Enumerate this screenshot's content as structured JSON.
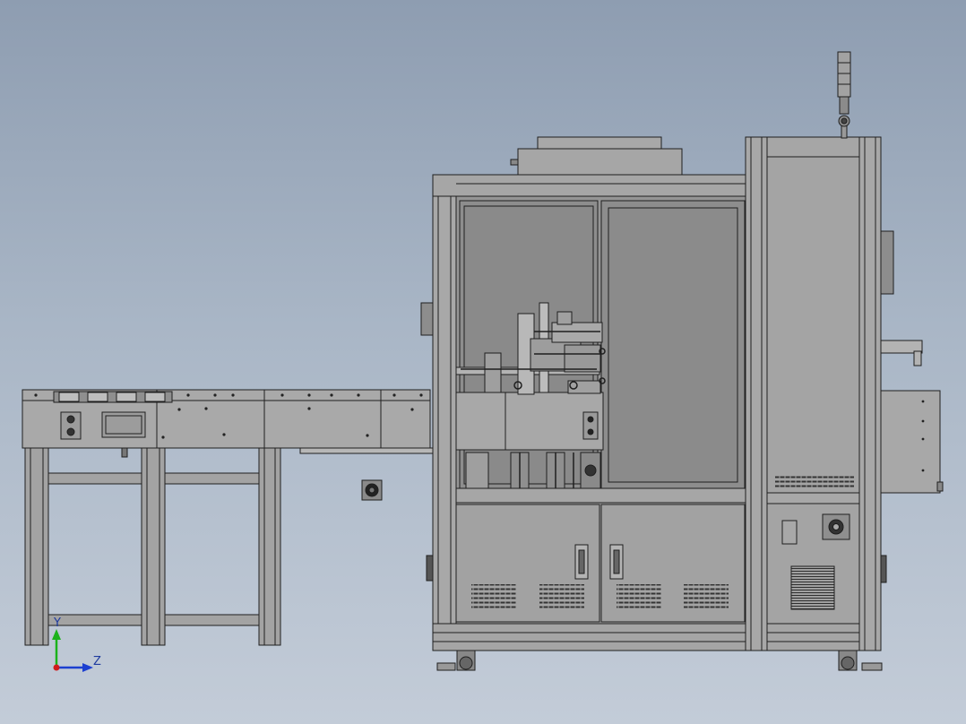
{
  "triad": {
    "y_label": "Y",
    "z_label": "Z",
    "x_color": "#d01c1c",
    "y_color": "#1bb21b",
    "z_color": "#1c3fd0"
  },
  "colors": {
    "background_top": "#8e9db1",
    "background_bottom": "#c3ccd8",
    "body_fill": "#a3a3a3",
    "panel_fill": "#9a9a9a",
    "line_stroke": "#1f1f1f"
  },
  "parts": {
    "signal_tower_levels": 4,
    "cabinet_vent_groups": 4,
    "door_handles": 2
  }
}
